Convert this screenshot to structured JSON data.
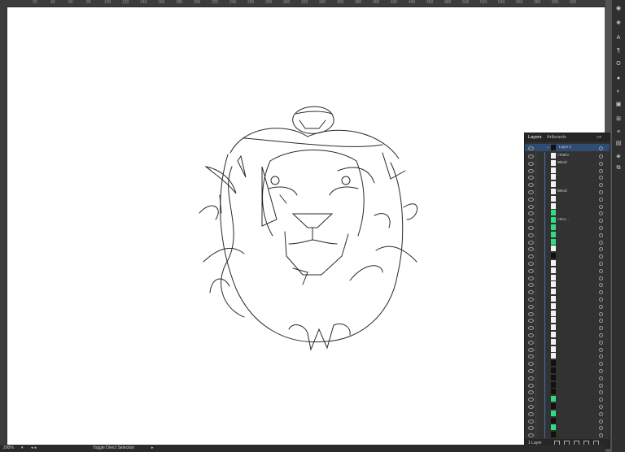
{
  "ruler": {
    "ticks": [
      "20",
      "40",
      "60",
      "80",
      "100",
      "120",
      "140",
      "160",
      "180",
      "200",
      "220",
      "240",
      "260",
      "280",
      "300",
      "320",
      "340",
      "360",
      "380",
      "400",
      "420",
      "440",
      "460",
      "480",
      "500",
      "520",
      "540",
      "560",
      "580",
      "600",
      "620"
    ]
  },
  "status": {
    "zoom": "200%",
    "tool_hint": "Toggle Direct Selection"
  },
  "layers_panel": {
    "tabs": [
      "Layers",
      "Artboards"
    ],
    "top_layer": "Layer 1",
    "row_labels": [
      "<Path>",
      "Blend",
      "Blend",
      "<Gro..."
    ],
    "footer_count": "1 Layer",
    "accent_color": "#2fdc85",
    "selected_row_color": "#2f4c73"
  },
  "icons": [
    "eye-icon",
    "visibility-circle-icon",
    "disclosure-triangle-icon",
    "panel-menu-icon",
    "new-layer-icon",
    "delete-icon",
    "locate-object-icon",
    "clipping-mask-icon",
    "sublayer-icon"
  ]
}
